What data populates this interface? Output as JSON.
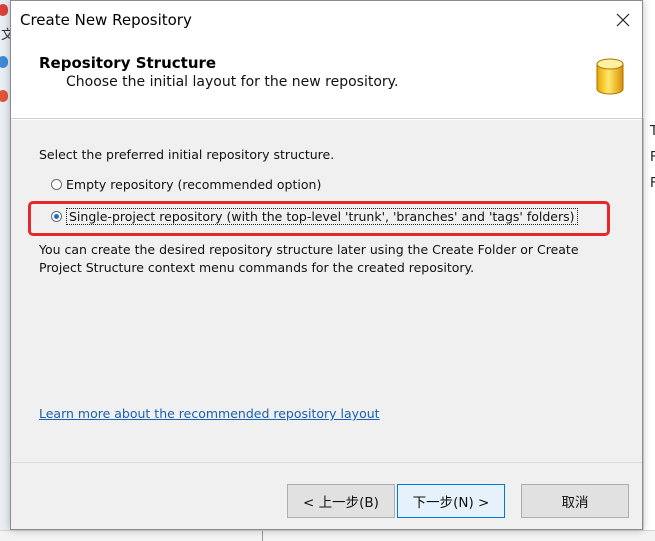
{
  "window": {
    "title": "Create New Repository"
  },
  "header": {
    "title": "Repository Structure",
    "subtitle": "Choose the initial layout for the new repository.",
    "icon": "database-icon"
  },
  "body": {
    "prompt": "Select the preferred initial repository structure.",
    "options": [
      {
        "label": "Empty repository (recommended option)",
        "checked": false
      },
      {
        "label": "Single-project repository (with the top-level 'trunk', 'branches' and 'tags' folders)",
        "checked": true
      }
    ],
    "note": "You can create the desired repository structure later using the Create Folder or Create Project Structure context menu commands for the created repository.",
    "link": "Learn more about the recommended repository layout"
  },
  "buttons": {
    "back": "< 上一步(B)",
    "next": "下一步(N) >",
    "cancel": "取消"
  },
  "background": {
    "left_glyphs": [
      "文"
    ],
    "right_glyphs": [
      "T",
      "F",
      "F"
    ]
  },
  "colors": {
    "highlight": "#e8272d",
    "link": "#1a5fb4",
    "default_button_border": "#0078d7",
    "radio_dot": "#1a6fd1"
  }
}
